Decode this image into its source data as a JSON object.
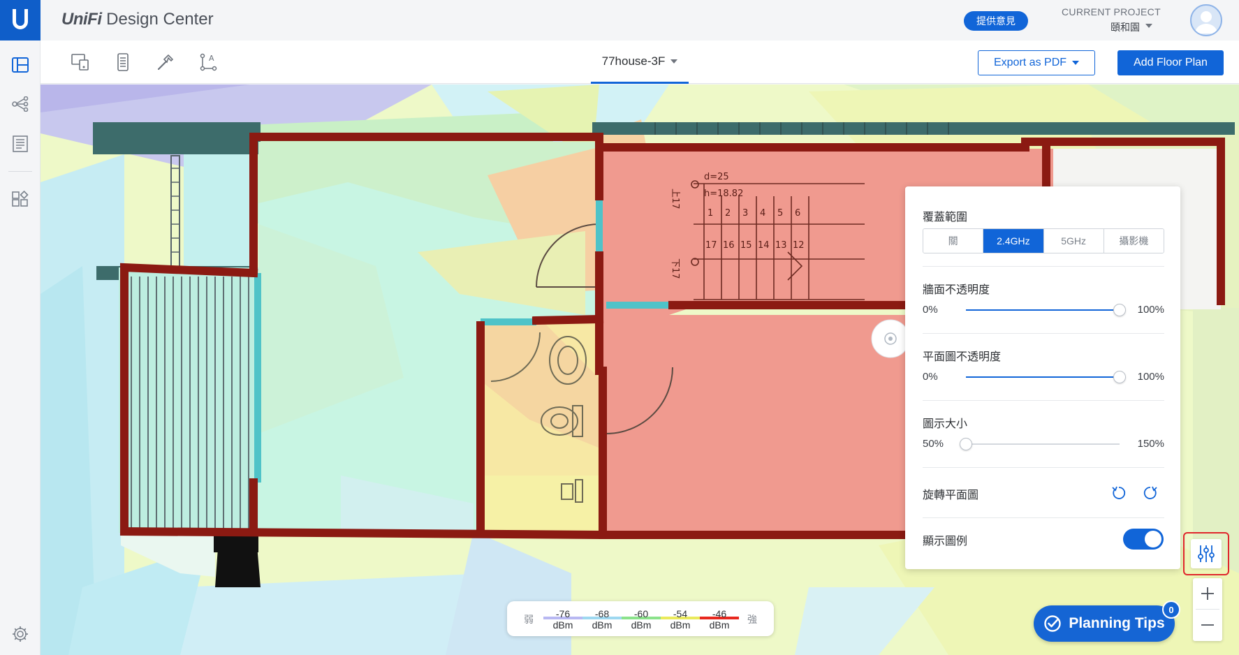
{
  "app": {
    "brand_logo": "UniFi",
    "brand_name": "Design Center"
  },
  "header": {
    "feedback_label": "提供意見",
    "project_label": "CURRENT PROJECT",
    "project_name": "頤和園"
  },
  "sidebar": {
    "items": [
      {
        "icon": "floorplan-icon",
        "active": true
      },
      {
        "icon": "topology-icon",
        "active": false
      },
      {
        "icon": "bill-of-materials-icon",
        "active": false
      },
      {
        "icon": "apps-icon",
        "active": false
      }
    ],
    "settings_icon": "gear-icon"
  },
  "toolbar": {
    "tools": [
      "device-placement-icon",
      "wall-tool-icon",
      "hammer-icon",
      "measure-icon"
    ],
    "floor_name": "77house-3F",
    "export_label": "Export as PDF",
    "add_floor_label": "Add Floor Plan"
  },
  "panel": {
    "coverage_label": "覆蓋範圍",
    "coverage_options": [
      "關",
      "2.4GHz",
      "5GHz",
      "攝影機"
    ],
    "coverage_selected": "2.4GHz",
    "wall_opacity_label": "牆面不透明度",
    "wall_opacity_min": "0%",
    "wall_opacity_max": "100%",
    "wall_opacity_value": 1.0,
    "plan_opacity_label": "平面圖不透明度",
    "plan_opacity_min": "0%",
    "plan_opacity_max": "100%",
    "plan_opacity_value": 1.0,
    "icon_size_label": "圖示大小",
    "icon_size_min": "50%",
    "icon_size_max": "150%",
    "icon_size_value": 0.0,
    "rotate_label": "旋轉平面圖",
    "legend_label": "顯示圖例",
    "legend_enabled": true
  },
  "legend": {
    "weak_label": "弱",
    "strong_label": "強",
    "unit": "dBm",
    "levels": [
      {
        "value": "-76",
        "color": "#b8b8f2"
      },
      {
        "value": "-68",
        "color": "#9ed8f0"
      },
      {
        "value": "-60",
        "color": "#8be28b"
      },
      {
        "value": "-54",
        "color": "#eaea5c"
      },
      {
        "value": "-46",
        "color": "#e8281e"
      }
    ]
  },
  "planning": {
    "tips_label": "Planning Tips",
    "tips_count": "0"
  },
  "floorplan": {
    "dim_d": "d=25",
    "dim_h": "h=18.82",
    "stair_up": "上17",
    "stair_down": "下17",
    "steps_top": [
      "1",
      "2",
      "3",
      "4",
      "5",
      "6"
    ],
    "steps_bottom": [
      "17",
      "16",
      "15",
      "14",
      "13",
      "12"
    ]
  },
  "colors": {
    "accent": "#1165d8",
    "wall": "#8b1a12",
    "door": "#4fc3c8",
    "highlight": "#e0262c"
  }
}
